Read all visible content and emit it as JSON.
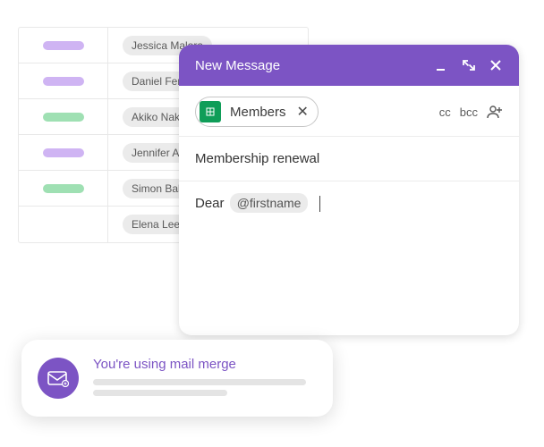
{
  "contacts": {
    "rows": [
      {
        "pill_color": "pill-purple",
        "name": "Jessica Malora"
      },
      {
        "pill_color": "pill-purple",
        "name": "Daniel Ferr"
      },
      {
        "pill_color": "pill-green",
        "name": "Akiko Naka"
      },
      {
        "pill_color": "pill-purple",
        "name": "Jennifer Ac"
      },
      {
        "pill_color": "pill-green",
        "name": "Simon Balli"
      },
      {
        "pill_color": "",
        "name": "Elena Lee"
      }
    ]
  },
  "compose": {
    "title": "New Message",
    "to_chip_label": "Members",
    "cc_label": "cc",
    "bcc_label": "bcc",
    "subject": "Membership renewal",
    "body_greeting": "Dear ",
    "merge_tag": "@firstname"
  },
  "toast": {
    "title": "You're using mail merge"
  }
}
